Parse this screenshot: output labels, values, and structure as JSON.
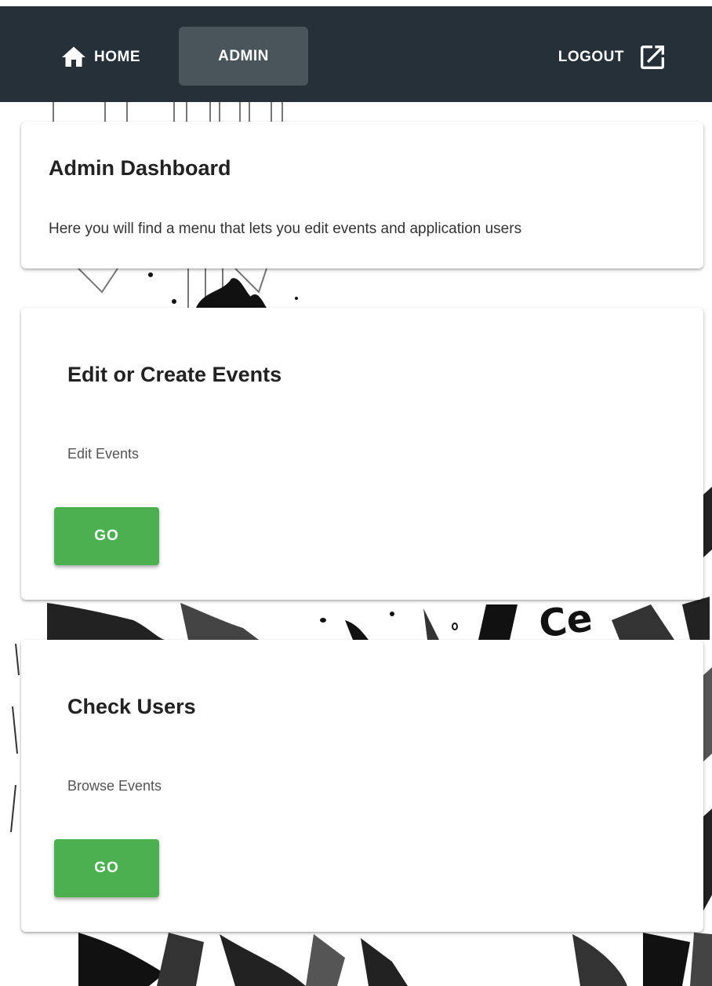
{
  "nav": {
    "home_label": "HOME",
    "admin_label": "ADMIN",
    "logout_label": "LOGOUT",
    "home_icon": "home-icon",
    "logout_icon": "open-in-new-icon",
    "bar_color": "#263038",
    "active_tab_color": "#4a545b"
  },
  "dashboard": {
    "title": "Admin Dashboard",
    "description": "Here you will find a menu that lets you edit events and application users"
  },
  "cards": [
    {
      "title": "Edit or Create Events",
      "description": "Edit Events",
      "button_label": "GO"
    },
    {
      "title": "Check Users",
      "description": "Browse Events",
      "button_label": "GO"
    }
  ],
  "colors": {
    "go_button": "#4caf50"
  }
}
